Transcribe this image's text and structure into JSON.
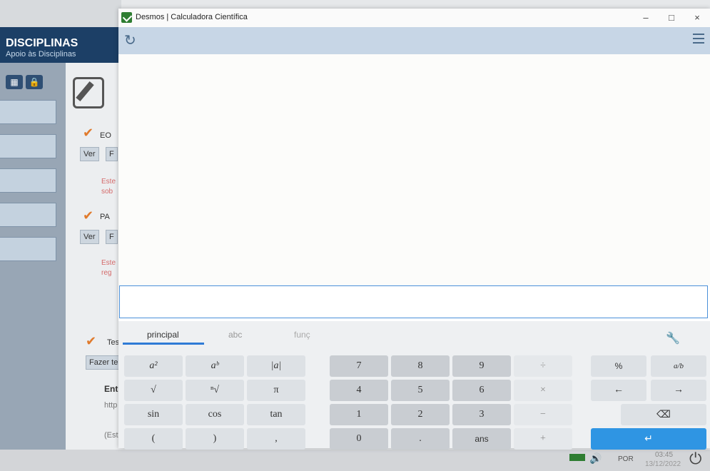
{
  "background_app": {
    "header_title": "DISCIPLINAS",
    "header_subtitle": "Apoio às Disciplinas",
    "items": [
      {
        "label": "EO",
        "btn1": "Ver",
        "btn2": "F",
        "red1": "Este",
        "red2": "sob"
      },
      {
        "label": "PA",
        "btn1": "Ver",
        "btn2": "F",
        "red1": "Este",
        "red2": "reg"
      }
    ],
    "test_label": "Tes",
    "fazer_btn": "Fazer te",
    "ent_label": "Ent",
    "http_label": "http",
    "est_label": "(Est"
  },
  "window": {
    "title": "Desmos | Calculadora Científica",
    "controls": {
      "minimize": "–",
      "maximize": "□",
      "close": "×"
    }
  },
  "keypad": {
    "tabs": [
      "principal",
      "abc",
      "funç"
    ],
    "row1": [
      "a²",
      "aᵇ",
      "|a|",
      "7",
      "8",
      "9",
      "÷",
      "%",
      "a/b"
    ],
    "row2": [
      "√",
      "ⁿ√",
      "π",
      "4",
      "5",
      "6",
      "×",
      "←",
      "→"
    ],
    "row3": [
      "sin",
      "cos",
      "tan",
      "1",
      "2",
      "3",
      "−"
    ],
    "row4": [
      "(",
      ")",
      ",",
      "0",
      ".",
      "ans",
      "+"
    ],
    "backspace": "⌫",
    "enter": "↵"
  },
  "taskbar": {
    "language": "POR",
    "time": "03:45",
    "date": "13/12/2022"
  },
  "colors": {
    "accent": "#2f95e3",
    "header": "#1c3f66",
    "toolbar": "#c7d6e6"
  }
}
